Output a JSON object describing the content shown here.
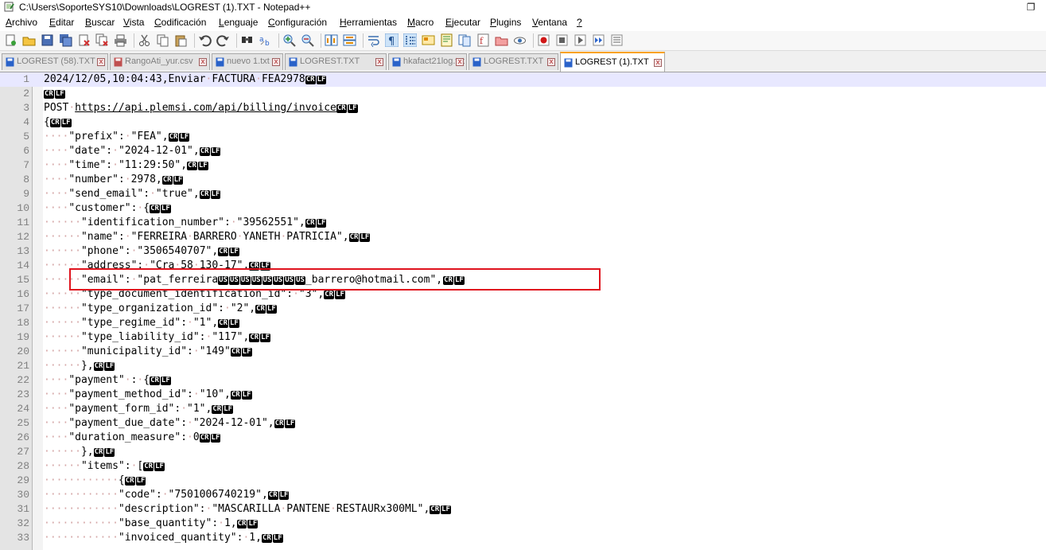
{
  "window": {
    "title": "C:\\Users\\SoporteSYS10\\Downloads\\LOGREST (1).TXT - Notepad++",
    "restore_glyph": "❐"
  },
  "menu": [
    {
      "accel": "A",
      "rest": "rchivo"
    },
    {
      "accel": "E",
      "rest": "ditar"
    },
    {
      "accel": "B",
      "rest": "uscar"
    },
    {
      "accel": "V",
      "rest": "ista"
    },
    {
      "accel": "C",
      "rest": "odificación"
    },
    {
      "accel": "L",
      "rest": "enguaje"
    },
    {
      "accel": "C",
      "rest": "onfiguración"
    },
    {
      "accel": "H",
      "rest": "erramientas"
    },
    {
      "accel": "M",
      "rest": "acro"
    },
    {
      "accel": "E",
      "rest": "jecutar"
    },
    {
      "accel": "P",
      "rest": "lugins"
    },
    {
      "accel": "V",
      "rest": "entana"
    },
    {
      "accel": "?",
      "rest": ""
    }
  ],
  "tabs": [
    {
      "label": "LOGREST (58).TXT",
      "active": false
    },
    {
      "label": "RangoAti_yur.csv",
      "active": false
    },
    {
      "label": "nuevo 1.txt",
      "active": false
    },
    {
      "label": "LOGREST.TXT",
      "active": false
    },
    {
      "label": "hkafact21log.txt",
      "active": false
    },
    {
      "label": "LOGREST.TXT",
      "active": false
    },
    {
      "label": "LOGREST (1).TXT",
      "active": true
    }
  ],
  "tab_close_glyph": "x",
  "control_chars": {
    "cr": "CR",
    "lf": "LF",
    "us": "US"
  },
  "whitespace_dot": "·",
  "colors": {
    "active_tab_accent": "#f9a21b",
    "current_line": "#e8e8ff",
    "highlight_box": "#e0141e",
    "whitespace": "#d4a5a5"
  },
  "editor": {
    "current_line": 1,
    "highlighted_line": 15,
    "lines": [
      {
        "n": 1,
        "indent": 0,
        "text": "2024/12/05,10:04:43,Enviar FACTURA FEA2978"
      },
      {
        "n": 2,
        "indent": 0,
        "text": ""
      },
      {
        "n": 3,
        "indent": 0,
        "text": "POST https://api.plemsi.com/api/billing/invoice",
        "url": "https://api.plemsi.com/api/billing/invoice"
      },
      {
        "n": 4,
        "indent": 0,
        "text": "{"
      },
      {
        "n": 5,
        "indent": 4,
        "text": "\"prefix\": \"FEA\","
      },
      {
        "n": 6,
        "indent": 4,
        "text": "\"date\": \"2024-12-01\","
      },
      {
        "n": 7,
        "indent": 4,
        "text": "\"time\": \"11:29:50\","
      },
      {
        "n": 8,
        "indent": 4,
        "text": "\"number\": 2978,"
      },
      {
        "n": 9,
        "indent": 4,
        "text": "\"send_email\": \"true\","
      },
      {
        "n": 10,
        "indent": 4,
        "text": "\"customer\": {"
      },
      {
        "n": 11,
        "indent": 6,
        "text": "\"identification_number\": \"39562551\","
      },
      {
        "n": 12,
        "indent": 6,
        "text": "\"name\": \"FERREIRA BARRERO YANETH PATRICIA\","
      },
      {
        "n": 13,
        "indent": 6,
        "text": "\"phone\": \"3506540707\","
      },
      {
        "n": 14,
        "indent": 6,
        "text": "\"address\": \"Cra 58 130-17\","
      },
      {
        "n": 15,
        "indent": 6,
        "text": "\"email\": \"pat_ferreira",
        "us_count": 8,
        "after": "_barrero@hotmail.com\","
      },
      {
        "n": 16,
        "indent": 6,
        "text": "\"type_document_identification_id\": \"3\","
      },
      {
        "n": 17,
        "indent": 6,
        "text": "\"type_organization_id\": \"2\","
      },
      {
        "n": 18,
        "indent": 6,
        "text": "\"type_regime_id\": \"1\","
      },
      {
        "n": 19,
        "indent": 6,
        "text": "\"type_liability_id\": \"117\","
      },
      {
        "n": 20,
        "indent": 6,
        "text": "\"municipality_id\": \"149\""
      },
      {
        "n": 21,
        "indent": 6,
        "text": "},"
      },
      {
        "n": 22,
        "indent": 4,
        "text": "\"payment\" : {"
      },
      {
        "n": 23,
        "indent": 4,
        "text": "\"payment_method_id\": \"10\","
      },
      {
        "n": 24,
        "indent": 4,
        "text": "\"payment_form_id\": \"1\","
      },
      {
        "n": 25,
        "indent": 4,
        "text": "\"payment_due_date\": \"2024-12-01\","
      },
      {
        "n": 26,
        "indent": 4,
        "text": "\"duration_measure\": 0"
      },
      {
        "n": 27,
        "indent": 6,
        "text": "},"
      },
      {
        "n": 28,
        "indent": 6,
        "text": "\"items\": ["
      },
      {
        "n": 29,
        "indent": 12,
        "text": "{"
      },
      {
        "n": 30,
        "indent": 12,
        "text": "\"code\": \"7501006740219\","
      },
      {
        "n": 31,
        "indent": 12,
        "text": "\"description\": \"MASCARILLA PANTENE RESTAURx300ML\","
      },
      {
        "n": 32,
        "indent": 12,
        "text": "\"base_quantity\": 1,"
      },
      {
        "n": 33,
        "indent": 12,
        "text": "\"invoiced_quantity\": 1,"
      }
    ]
  }
}
